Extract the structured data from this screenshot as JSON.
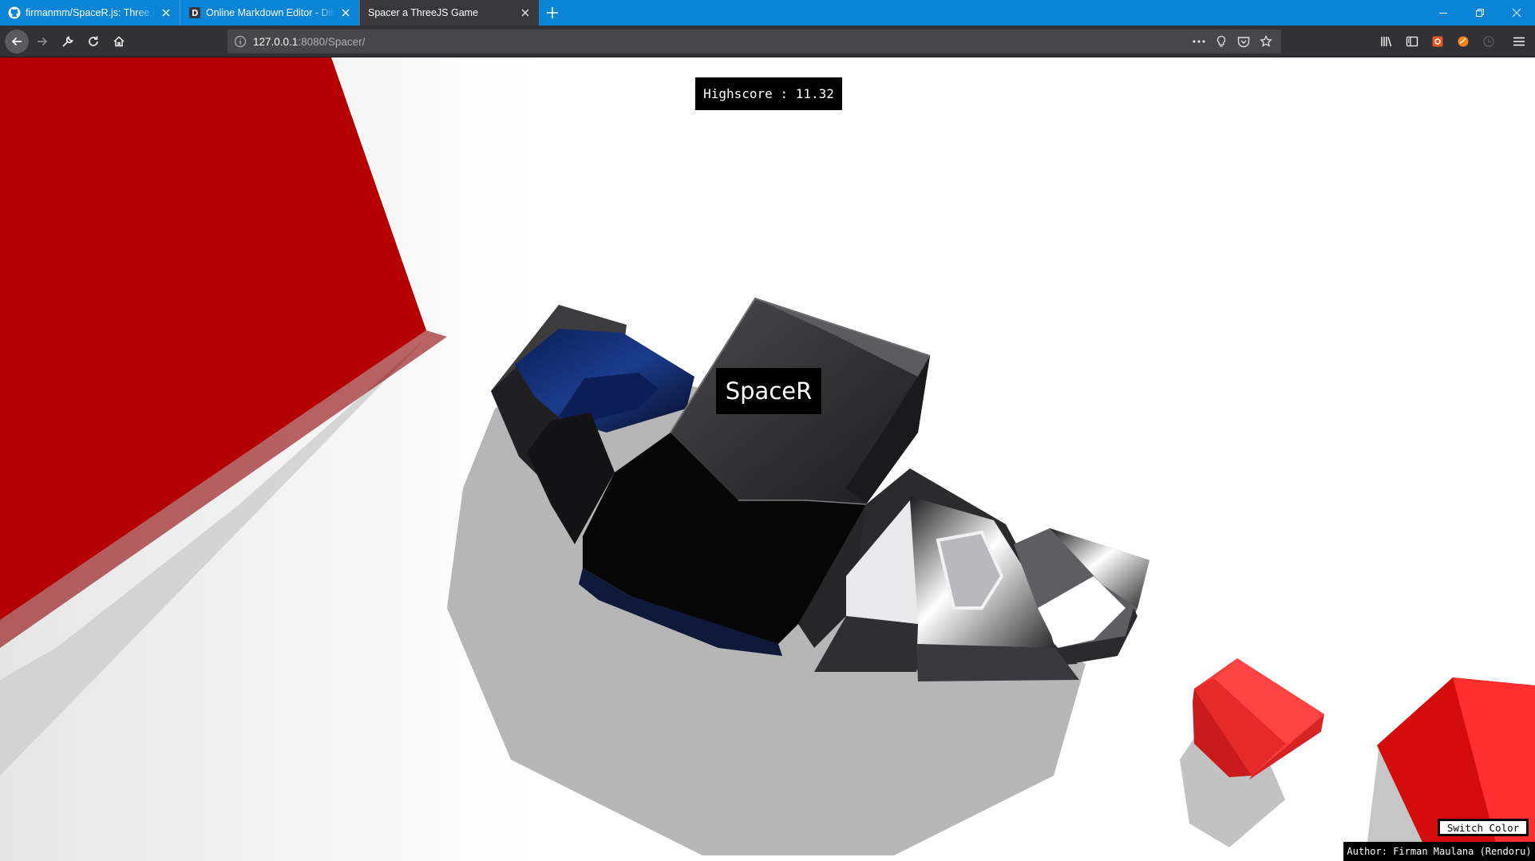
{
  "browser": {
    "tabs": [
      {
        "title": "firmanmm/SpaceR.js: Three.js Game",
        "icon": "github-icon",
        "active": false
      },
      {
        "title": "Online Markdown Editor - Dillinger",
        "icon": "dillinger-icon",
        "active": false
      },
      {
        "title": "Spacer a ThreeJS Game",
        "icon": "none",
        "active": true
      }
    ],
    "url": {
      "host": "127.0.0.1",
      "rest": ":8080/Spacer/"
    },
    "colors": {
      "titlebar": "#0a84d6",
      "toolbar": "#323234",
      "urlbar": "#474749"
    }
  },
  "game": {
    "highscore_label": "Highscore : 11.32",
    "title": "SpaceR",
    "switch_color_label": "Switch Color",
    "author_label": "Author: Firman Maulana (Rendoru)",
    "colors": {
      "obstacle": "#ff2a2a",
      "obstacle_dark": "#c40000",
      "ship": "#2c2c2e",
      "shadow": "#b8b8b8",
      "background": "#ffffff"
    }
  }
}
